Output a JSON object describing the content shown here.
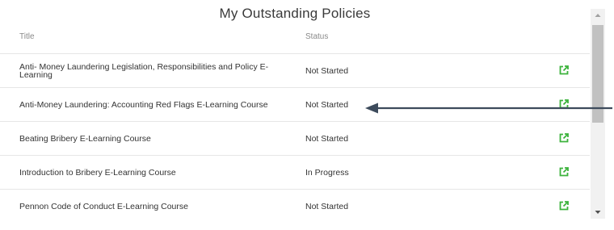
{
  "panel": {
    "title": "My Outstanding Policies",
    "columns": {
      "title": "Title",
      "status": "Status"
    },
    "rows": [
      {
        "title": "Anti- Money Laundering Legislation, Responsibilities and Policy E-Learning",
        "status": "Not Started"
      },
      {
        "title": "Anti-Money Laundering: Accounting Red Flags E-Learning Course",
        "status": "Not Started"
      },
      {
        "title": "Beating Bribery E-Learning Course",
        "status": "Not Started"
      },
      {
        "title": "Introduction to Bribery E-Learning Course",
        "status": "In Progress"
      },
      {
        "title": "Pennon Code of Conduct E-Learning Course",
        "status": "Not Started"
      }
    ]
  },
  "icons": {
    "row_action": "open-external-link-icon",
    "annotation": "left-arrow-icon"
  },
  "colors": {
    "action_icon": "#3cb33c",
    "annotation_arrow": "#3d4b5c",
    "scroll_thumb": "#c1c1c1"
  }
}
